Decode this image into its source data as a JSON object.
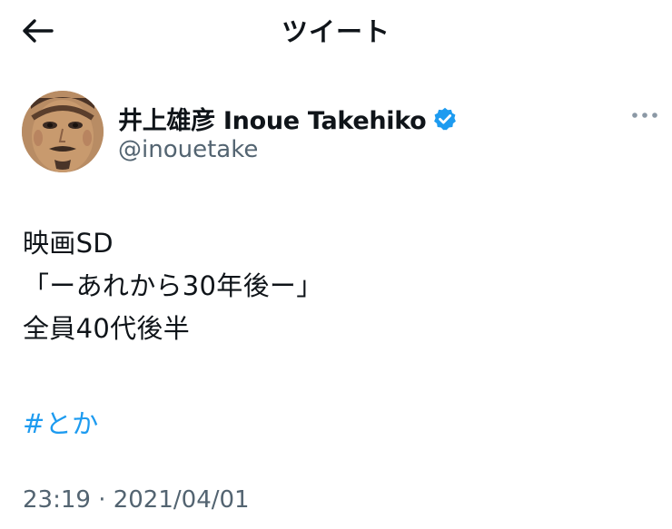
{
  "header": {
    "title": "ツイート",
    "back_icon": "arrow-left-icon"
  },
  "author": {
    "display_name": "井上雄彦 Inoue Takehiko",
    "handle": "@inouetake",
    "verified": true,
    "verified_icon": "verified-badge-icon"
  },
  "more_icon": "more-dots-icon",
  "tweet": {
    "lines": [
      "映画SD",
      "「ーあれから30年後ー」",
      "全員40代後半"
    ],
    "hashtag": "#とか",
    "timestamp": "23:19 · 2021/04/01"
  },
  "colors": {
    "text": "#0f1419",
    "secondary": "#536471",
    "link": "#1d9bf0",
    "verified": "#1d9bf0"
  }
}
